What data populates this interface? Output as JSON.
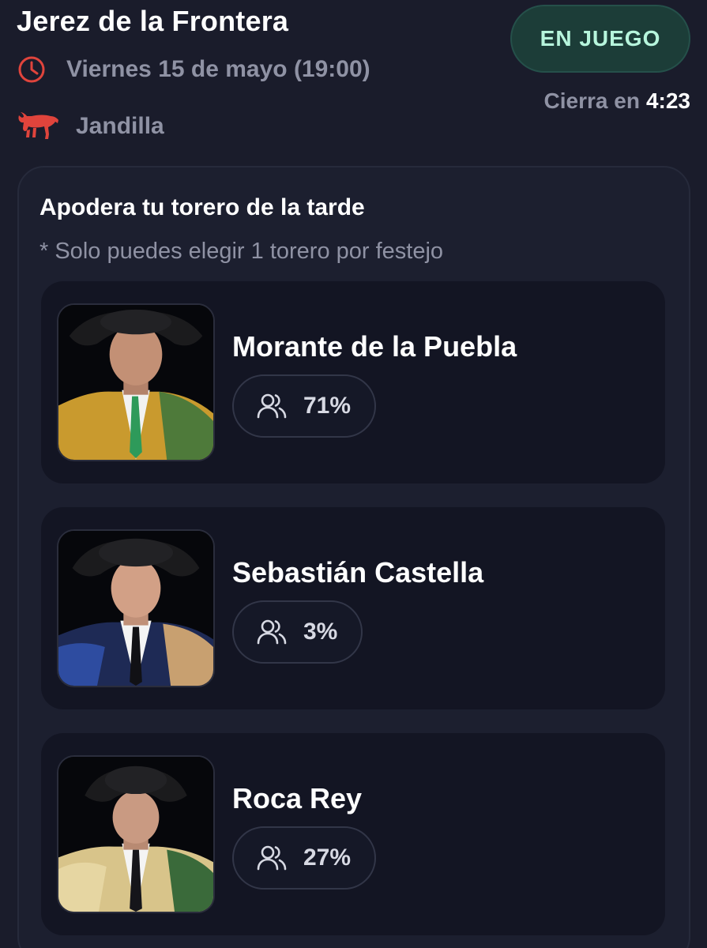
{
  "event": {
    "venue": "Jerez de la Frontera",
    "date_time": "Viernes 15 de mayo (19:00)",
    "ganaderia": "Jandilla",
    "status": "EN JUEGO",
    "closes_label": "Cierra en",
    "closes_time": "4:23"
  },
  "colors": {
    "background": "#1a1c2b",
    "accent_red": "#e0443c",
    "status_green_text": "#b6f5dc",
    "status_green_bg": "#1c3d38",
    "muted_text": "#8f92a4"
  },
  "icons": {
    "date": "clock-icon",
    "ganaderia": "bull-icon",
    "votes": "users-icon"
  },
  "picker": {
    "title": "Apodera tu torero de la tarde",
    "note": "* Solo puedes elegir 1 torero por festejo",
    "toreros": [
      {
        "name": "Morante de la Puebla",
        "percent": "71%"
      },
      {
        "name": "Sebastián Castella",
        "percent": "3%"
      },
      {
        "name": "Roca Rey",
        "percent": "27%"
      }
    ]
  }
}
